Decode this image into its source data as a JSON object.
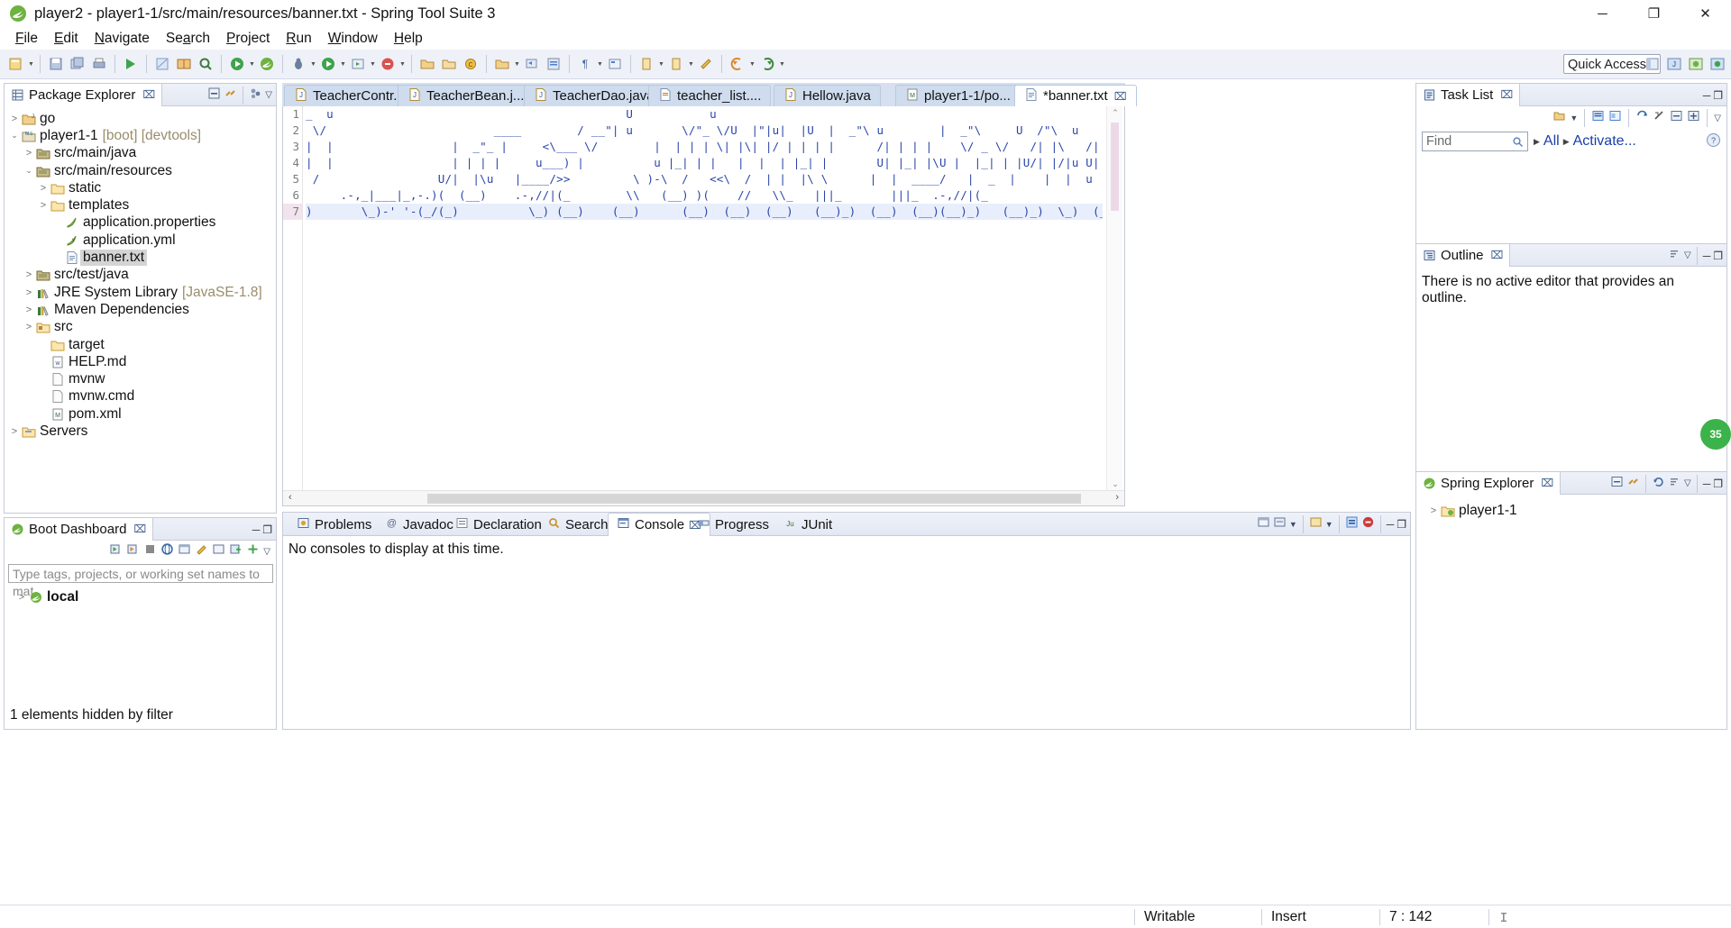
{
  "window": {
    "title": "player2 - player1-1/src/main/resources/banner.txt - Spring Tool Suite 3",
    "app_icon": "spring-leaf-icon",
    "minimize_label": "─",
    "maximize_label": "❐",
    "close_label": "✕"
  },
  "menubar": {
    "items": [
      {
        "label": "File",
        "mnemonic": "F"
      },
      {
        "label": "Edit",
        "mnemonic": "E"
      },
      {
        "label": "Navigate",
        "mnemonic": "N"
      },
      {
        "label": "Search",
        "mnemonic": "a"
      },
      {
        "label": "Project",
        "mnemonic": "P"
      },
      {
        "label": "Run",
        "mnemonic": "R"
      },
      {
        "label": "Window",
        "mnemonic": "W"
      },
      {
        "label": "Help",
        "mnemonic": "H"
      }
    ]
  },
  "toolbar": {
    "quick_access_placeholder": "Quick Access",
    "quick_access_value": "Quick Access",
    "buttons": [
      "new-wizard-icon",
      "save-icon",
      "save-all-icon",
      "print-icon",
      "build-all-icon",
      "search-icon",
      "boot-run-icon",
      "spring-icon",
      "link-icon",
      "open-type-icon",
      "debug-icon",
      "run-icon",
      "run-external-icon",
      "coverage-icon",
      "new-java-project-icon",
      "new-package-icon",
      "new-class-icon",
      "open-task-icon",
      "new-task-icon",
      "synchronize-icon",
      "pilcrow-icon",
      "toggle-mark-icon",
      "previous-annotation-icon",
      "next-annotation-icon",
      "last-edit-icon",
      "back-icon",
      "forward-icon"
    ],
    "perspective_buttons": [
      "open-perspective-icon",
      "java-perspective-icon",
      "spring-perspective-icon",
      "boot-perspective-icon"
    ]
  },
  "package_explorer": {
    "tab_label": "Package Explorer",
    "tab_icon": "package-explorer-icon",
    "tools": [
      "collapse-all-icon",
      "link-with-editor-icon",
      "view-menu-presentation-icon",
      "view-menu-icon"
    ],
    "minimize_label": "─",
    "maximize_label": "❐",
    "tree": [
      {
        "label": "go",
        "icon": "java-project-icon",
        "arrow": "collapsed",
        "indent": 0,
        "sub": "",
        "selected": false
      },
      {
        "label": "player1-1",
        "icon": "maven-spring-project-icon",
        "arrow": "expanded",
        "indent": 0,
        "sub": "[boot] [devtools]",
        "selected": false
      },
      {
        "label": "src/main/java",
        "icon": "source-folder-icon",
        "arrow": "collapsed",
        "indent": 1,
        "sub": "",
        "selected": false
      },
      {
        "label": "src/main/resources",
        "icon": "source-folder-icon",
        "arrow": "expanded",
        "indent": 1,
        "sub": "",
        "selected": false
      },
      {
        "label": "static",
        "icon": "folder-icon",
        "arrow": "collapsed",
        "indent": 2,
        "sub": "",
        "selected": false
      },
      {
        "label": "templates",
        "icon": "folder-icon",
        "arrow": "collapsed",
        "indent": 2,
        "sub": "",
        "selected": false
      },
      {
        "label": "application.properties",
        "icon": "properties-file-icon",
        "arrow": "none",
        "indent": 3,
        "sub": "",
        "selected": false
      },
      {
        "label": "application.yml",
        "icon": "yaml-file-icon",
        "arrow": "none",
        "indent": 3,
        "sub": "",
        "selected": false
      },
      {
        "label": "banner.txt",
        "icon": "text-file-icon",
        "arrow": "none",
        "indent": 3,
        "sub": "",
        "selected": true
      },
      {
        "label": "src/test/java",
        "icon": "source-folder-icon",
        "arrow": "collapsed",
        "indent": 1,
        "sub": "",
        "selected": false
      },
      {
        "label": "JRE System Library",
        "icon": "library-icon",
        "arrow": "collapsed",
        "indent": 1,
        "sub": "[JavaSE-1.8]",
        "selected": false
      },
      {
        "label": "Maven Dependencies",
        "icon": "library-icon",
        "arrow": "collapsed",
        "indent": 1,
        "sub": "",
        "selected": false
      },
      {
        "label": "src",
        "icon": "folder-locked-icon",
        "arrow": "collapsed",
        "indent": 1,
        "sub": "",
        "selected": false
      },
      {
        "label": "target",
        "icon": "folder-icon",
        "arrow": "none",
        "indent": 2,
        "sub": "",
        "selected": false
      },
      {
        "label": "HELP.md",
        "icon": "markdown-file-icon",
        "arrow": "none",
        "indent": 2,
        "sub": "",
        "selected": false
      },
      {
        "label": "mvnw",
        "icon": "file-icon",
        "arrow": "none",
        "indent": 2,
        "sub": "",
        "selected": false
      },
      {
        "label": "mvnw.cmd",
        "icon": "file-icon",
        "arrow": "none",
        "indent": 2,
        "sub": "",
        "selected": false
      },
      {
        "label": "pom.xml",
        "icon": "maven-pom-icon",
        "arrow": "none",
        "indent": 2,
        "sub": "",
        "selected": false
      },
      {
        "label": "Servers",
        "icon": "servers-folder-icon",
        "arrow": "collapsed",
        "indent": 0,
        "sub": "",
        "selected": false
      }
    ]
  },
  "editor": {
    "tabs": [
      {
        "label": "TeacherContr...",
        "icon": "java-file-icon",
        "active": false,
        "dirty": false
      },
      {
        "label": "TeacherBean.j...",
        "icon": "java-file-icon",
        "active": false,
        "dirty": false
      },
      {
        "label": "TeacherDao.java",
        "icon": "java-file-icon",
        "active": false,
        "dirty": false
      },
      {
        "label": "teacher_list....",
        "icon": "html-file-icon",
        "active": false,
        "dirty": false
      },
      {
        "label": "Hellow.java",
        "icon": "java-file-icon",
        "active": false,
        "dirty": false
      },
      {
        "label": "player1-1/po...",
        "icon": "maven-pom-icon",
        "active": false,
        "dirty": false
      },
      {
        "label": "*banner.txt",
        "icon": "text-file-icon",
        "active": true,
        "dirty": true
      }
    ],
    "tab_close_label": "⌧",
    "minimize_label": "─",
    "maximize_label": "❐",
    "line_numbers": [
      "1",
      "2",
      "3",
      "4",
      "5",
      "6",
      "7"
    ],
    "current_line": 7,
    "lines": [
      "_  u                                          U           u                                                                      ",
      " \\/                        ____        / __\"| u       \\/\"_ \\/U  |\"|u|  |U  |  _\"\\ u        |  _\"\\     U  /\"\\  u   |\"\\     |  \"\\  \\ \\ / /",
      "|  |                 |  _\"_ |     <\\___ \\/        |  | | | \\| |\\| |/ | | | |      /| | | |    \\/ _ \\/   /| |\\   /| |\\   \\ V /",
      "|  |                 | | | |     u___) |          u |_| | |   |  |  | |_| |       U| |_| |\\U |  |_| | |U/| |/|u U| |/| |u |\\U_|\"|_u",
      " /                 U/|  |\\u   |____/>>         \\ )-\\  /   <<\\  /  | |  |\\ \\      |  |  ____/   |  _  |    |  |  u   |  |  u   |  _|",
      "     .-,_|___|_,-.)(  (__)    .-,//|(_        \\\\   (__) )(    //   \\\\_   |||_       |||_  .-,//|(_",
      ")       \\_)-' '-(_/(_)          \\_) (__)    (__)      (__)  (__)  (__)   (__)_)  (__)  (__)(__)_)   (__)_)  \\_)  (__) "
    ],
    "cursor_position": "7 : 142",
    "scroll_up_label": "⌃",
    "scroll_down_label": "⌄",
    "hscroll_left_label": "‹",
    "hscroll_right_label": "›"
  },
  "bottom_panel": {
    "tabs": [
      {
        "label": "Problems",
        "icon": "problems-icon",
        "active": false
      },
      {
        "label": "Javadoc",
        "icon": "javadoc-icon",
        "active": false
      },
      {
        "label": "Declaration",
        "icon": "declaration-icon",
        "active": false
      },
      {
        "label": "Search",
        "icon": "search-icon",
        "active": false
      },
      {
        "label": "Console",
        "icon": "console-icon",
        "active": true
      },
      {
        "label": "Progress",
        "icon": "progress-icon",
        "active": false
      },
      {
        "label": "JUnit",
        "icon": "junit-icon",
        "active": false
      }
    ],
    "close_label": "⌧",
    "console_message": "No consoles to display at this time.",
    "tools": [
      "open-console-icon",
      "display-selected-console-icon",
      "dropdown-icon",
      "new-console-view-icon",
      "pin-console-icon",
      "spring-console-icon",
      "error-console-icon"
    ],
    "minimize_label": "─",
    "maximize_label": "❐"
  },
  "boot_dashboard": {
    "tab_label": "Boot Dashboard",
    "tab_icon": "boot-dashboard-icon",
    "close_label": "⌧",
    "minimize_label": "─",
    "maximize_label": "❐",
    "tools": [
      "start-icon",
      "restart-icon",
      "stop-icon",
      "open-web-icon",
      "open-browser-icon",
      "edit-config-icon",
      "open-console-icon",
      "add-project-icon",
      "add-icon",
      "view-menu-icon"
    ],
    "filter_placeholder": "Type tags, projects, or working set names to mat",
    "items": [
      {
        "label": "local",
        "icon": "local-server-icon",
        "arrow": "collapsed"
      }
    ],
    "footer": "1 elements hidden by filter"
  },
  "task_list": {
    "tab_label": "Task List",
    "tab_icon": "task-list-icon",
    "close_label": "⌧",
    "minimize_label": "─",
    "maximize_label": "❐",
    "tools": [
      "new-task-icon",
      "dropdown-icon",
      "categorized-icon",
      "scheduled-icon",
      "synchronize-icon",
      "focus-icon",
      "collapse-all-icon",
      "expand-all-icon",
      "view-menu-icon"
    ],
    "find_placeholder": "Find",
    "find_value": "Find",
    "find_icon": "search-icon",
    "filter_all": "All",
    "activate_link": "Activate...",
    "help_icon": "help-icon"
  },
  "outline": {
    "tab_label": "Outline",
    "tab_icon": "outline-icon",
    "close_label": "⌧",
    "minimize_label": "─",
    "maximize_label": "❐",
    "tools": [
      "sort-icon",
      "view-menu-icon"
    ],
    "message": "There is no active editor that provides an outline."
  },
  "spring_explorer": {
    "tab_label": "Spring Explorer",
    "tab_icon": "spring-icon",
    "close_label": "⌧",
    "minimize_label": "─",
    "maximize_label": "❐",
    "tools": [
      "collapse-all-icon",
      "link-with-editor-icon",
      "refresh-icon",
      "sort-icon",
      "view-menu-icon"
    ],
    "items": [
      {
        "label": "player1-1",
        "icon": "spring-project-icon",
        "arrow": "collapsed"
      }
    ]
  },
  "status_bar": {
    "writable": "Writable",
    "insert_mode": "Insert",
    "position": "7 : 142",
    "extra_icon": "smart-insert-icon"
  },
  "progress_badge": {
    "value": "35",
    "color": "#3bb34a"
  }
}
